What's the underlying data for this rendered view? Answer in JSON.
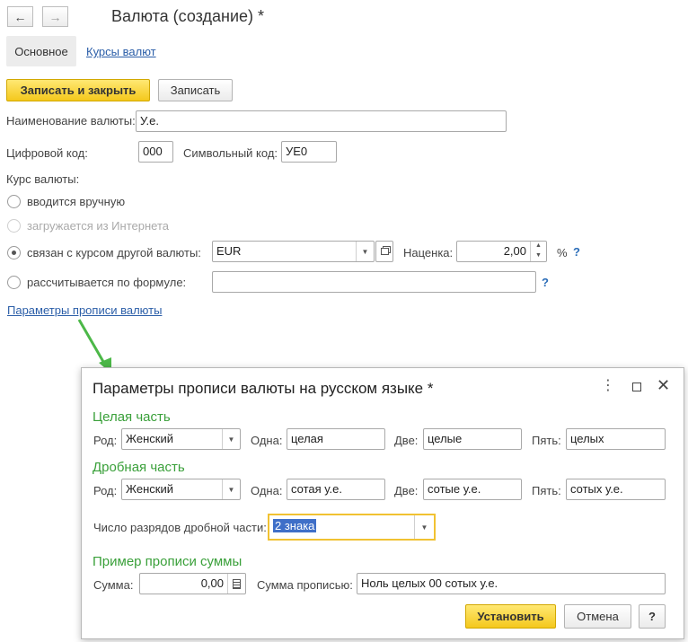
{
  "window": {
    "title": "Валюта (создание) *"
  },
  "tabs": [
    {
      "label": "Основное"
    },
    {
      "label": "Курсы валют"
    }
  ],
  "toolbar": {
    "save_close_label": "Записать и закрыть",
    "save_label": "Записать"
  },
  "form": {
    "name_label": "Наименование валюты:",
    "name_value": "У.е.",
    "digital_code_label": "Цифровой код:",
    "digital_code_value": "000",
    "symbol_code_label": "Символьный код:",
    "symbol_code_value": "УЕ0",
    "rate_label": "Курс валюты:",
    "rate_options": [
      {
        "label": "вводится вручную",
        "selected": false,
        "disabled": false
      },
      {
        "label": "загружается из Интернета",
        "selected": false,
        "disabled": true
      },
      {
        "label": "связан с курсом другой валюты:",
        "selected": true,
        "disabled": false
      },
      {
        "label": "рассчитывается по формуле:",
        "selected": false,
        "disabled": false
      }
    ],
    "linked_currency_value": "EUR",
    "markup_label": "Наценка:",
    "markup_value": "2,00",
    "percent_sign": "%",
    "help_mark": "?",
    "formula_value": "",
    "params_link": "Параметры прописи валюты"
  },
  "dialog": {
    "title": "Параметры прописи валюты на русском языке *",
    "whole_section": "Целая часть",
    "fraction_section": "Дробная часть",
    "gender_label": "Род:",
    "one_label": "Одна:",
    "two_label": "Две:",
    "five_label": "Пять:",
    "whole": {
      "gender": "Женский",
      "one": "целая",
      "two": "целые",
      "five": "целых"
    },
    "fraction": {
      "gender": "Женский",
      "one": "сотая у.е.",
      "two": "сотые у.е.",
      "five": "сотых у.е."
    },
    "digits_label": "Число разрядов дробной части:",
    "digits_value": "2 знака",
    "example_section": "Пример прописи суммы",
    "sum_label": "Сумма:",
    "sum_value": "0,00",
    "sum_words_label": "Сумма прописью:",
    "sum_words_value": "Ноль целых 00 сотых у.е.",
    "install_label": "Установить",
    "cancel_label": "Отмена",
    "help_label": "?"
  },
  "colors": {
    "accent_yellow": "#f4c81c",
    "link_blue": "#2b5ea8",
    "section_green": "#3aa03a",
    "arrow_green": "#4cb848"
  }
}
